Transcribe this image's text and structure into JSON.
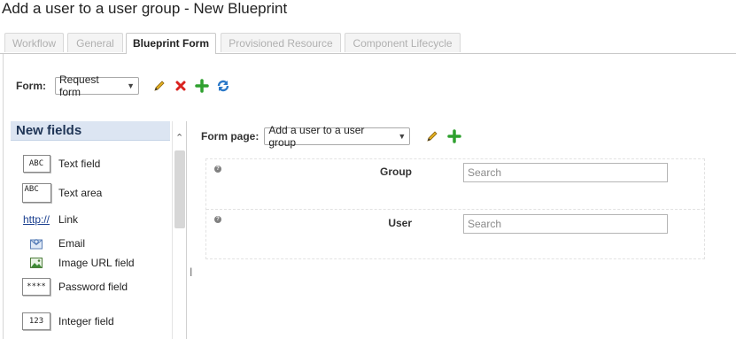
{
  "window": {
    "title": "Add a user to a user group - New Blueprint"
  },
  "tabs": [
    {
      "label": "Workflow",
      "active": false
    },
    {
      "label": "General",
      "active": false
    },
    {
      "label": "Blueprint Form",
      "active": true
    },
    {
      "label": "Provisioned Resource",
      "active": false
    },
    {
      "label": "Component Lifecycle",
      "active": false
    }
  ],
  "form_selector": {
    "label": "Form:",
    "value": "Request form",
    "actions": [
      "edit-icon",
      "delete-icon",
      "add-icon",
      "refresh-icon"
    ]
  },
  "new_fields": {
    "header": "New fields",
    "items": [
      {
        "label": "Text field",
        "icon": "text-field-icon",
        "icon_text": "ABC"
      },
      {
        "label": "Text area",
        "icon": "text-area-icon",
        "icon_text": "ABC"
      },
      {
        "label": "Link",
        "icon": "link-icon",
        "icon_text": "http://"
      },
      {
        "label": "Email",
        "icon": "email-icon"
      },
      {
        "label": "Image URL field",
        "icon": "image-icon"
      },
      {
        "label": "Password field",
        "icon": "password-field-icon",
        "icon_text": "****"
      },
      {
        "label": "Integer field",
        "icon": "integer-field-icon",
        "icon_text": "123"
      }
    ]
  },
  "form_page": {
    "label": "Form page:",
    "value": "Add a user to a user group",
    "actions": [
      "edit-icon",
      "add-icon"
    ]
  },
  "form_fields": [
    {
      "label": "Group",
      "placeholder": "Search",
      "value": ""
    },
    {
      "label": "User",
      "placeholder": "Search",
      "value": ""
    }
  ],
  "colors": {
    "panel_header_bg": "#dce5f2",
    "panel_header_text": "#1f3556",
    "delete": "#d9221f",
    "add": "#2ea02e",
    "refresh": "#2a78c8",
    "edit": "#d9a21a"
  }
}
